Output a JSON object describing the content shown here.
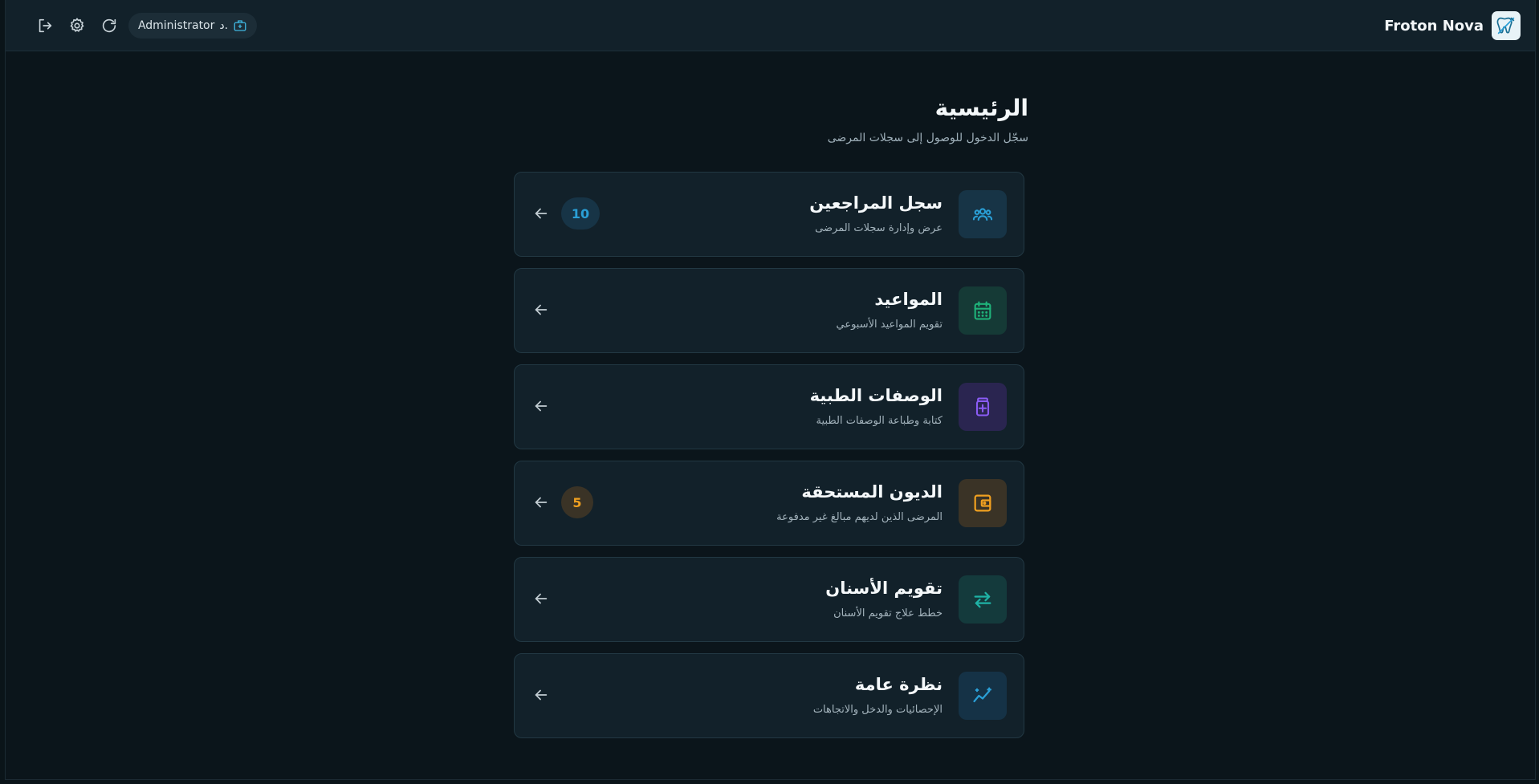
{
  "header": {
    "user": {
      "prefix": "د.",
      "name": "Administrator"
    },
    "brand": {
      "name": "Froton Nova"
    }
  },
  "page": {
    "title": "الرئيسية",
    "subtitle": "سجّل الدخول للوصول إلى سجلات المرضى"
  },
  "cards": [
    {
      "title": "سجل المراجعين",
      "desc": "عرض وإدارة سجلات المرضى",
      "badge": "10",
      "icon": "users-icon",
      "color": "#2a9fd6",
      "bg": "#173446"
    },
    {
      "title": "المواعيد",
      "desc": "تقويم المواعيد الأسبوعي",
      "badge": "",
      "icon": "calendar-icon",
      "color": "#1fb37a",
      "bg": "#153a36"
    },
    {
      "title": "الوصفات الطبية",
      "desc": "كتابة وطباعة الوصفات الطبية",
      "badge": "",
      "icon": "medicine-icon",
      "color": "#8b5cf6",
      "bg": "#2a2550"
    },
    {
      "title": "الديون المستحقة",
      "desc": "المرضى الذين لديهم مبالغ غير مدفوعة",
      "badge": "5",
      "icon": "wallet-icon",
      "color": "#f0a020",
      "bg": "#3a3326"
    },
    {
      "title": "تقويم الأسنان",
      "desc": "خطط علاج تقويم الأسنان",
      "badge": "",
      "icon": "swap-arrows-icon",
      "color": "#1fb3a6",
      "bg": "#143a3c"
    },
    {
      "title": "نظرة عامة",
      "desc": "الإحصائيات والدخل والاتجاهات",
      "badge": "",
      "icon": "trend-sparkle-icon",
      "color": "#2a9fd6",
      "bg": "#153246"
    }
  ],
  "colors": {
    "badge_blue_bg": "#173446",
    "badge_blue_fg": "#2a9fd6",
    "badge_amber_bg": "#3a3326",
    "badge_amber_fg": "#f0a020"
  }
}
